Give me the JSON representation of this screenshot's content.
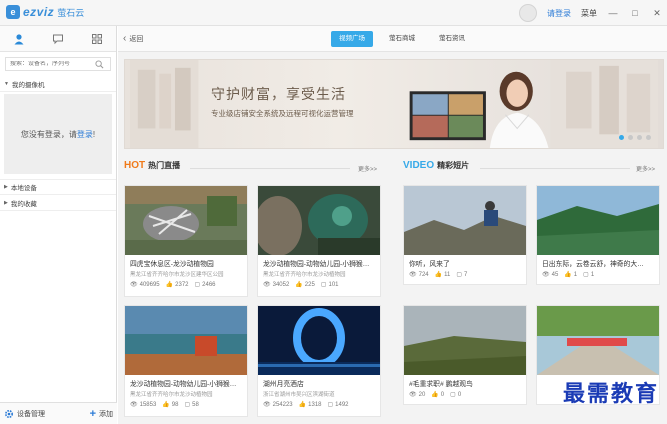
{
  "titlebar": {
    "logo_text": "ezviz",
    "logo_cn": "萤石云",
    "login_label": "请登录",
    "menu_label": "菜单"
  },
  "sidebar": {
    "search_placeholder": "搜索：设备名，序列号",
    "my_cameras": "我的摄像机",
    "empty_prefix": "您没有登录，请",
    "empty_link": "登录",
    "empty_suffix": "!",
    "local_devices": "本地设备",
    "my_favorites": "我的收藏",
    "device_manage": "设备管理",
    "add_label": "添加"
  },
  "nav": {
    "back_label": "返回",
    "tabs": [
      "视频广场",
      "萤石商城",
      "萤石资讯"
    ]
  },
  "banner": {
    "title": "守护财富，享受生活",
    "subtitle": "专业级店铺安全系统及远程可视化运营管理"
  },
  "hot": {
    "en": "HOT",
    "cn": "热门直播",
    "more": "更多>>",
    "cards": [
      {
        "title": "四虎宝休息区-龙沙动植物园",
        "addr": "黑龙江省齐齐哈尔市龙沙区建华区公园",
        "views": "409695",
        "likes": "2372",
        "comments": "2466"
      },
      {
        "title": "龙沙动植物园-动物幼儿园-小狮猴…",
        "addr": "黑龙江省齐齐哈尔市龙沙动植物园",
        "views": "34052",
        "likes": "225",
        "comments": "101"
      },
      {
        "title": "龙沙动植物园-动物幼儿园-小狮猴…",
        "addr": "黑龙江省齐齐哈尔市龙沙动植物园",
        "views": "15853",
        "likes": "98",
        "comments": "58"
      },
      {
        "title": "湖州月亮酒店",
        "addr": "浙江省湖州市吴兴区滨湖街道",
        "views": "254223",
        "likes": "1318",
        "comments": "1492"
      }
    ]
  },
  "video": {
    "en": "VIDEO",
    "cn": "精彩短片",
    "more": "更多>>",
    "cards": [
      {
        "title": "你听，风来了",
        "views": "724",
        "likes": "11",
        "comments": "7"
      },
      {
        "title": "日出东际，云卷云舒，神奇的大…",
        "views": "45",
        "likes": "1",
        "comments": "1"
      },
      {
        "title": "#毛重求职# 鹏越观鸟",
        "views": "20",
        "likes": "0",
        "comments": "0"
      },
      {
        "title": "",
        "views": "",
        "likes": "",
        "comments": ""
      }
    ]
  },
  "watermark": "最需教育"
}
